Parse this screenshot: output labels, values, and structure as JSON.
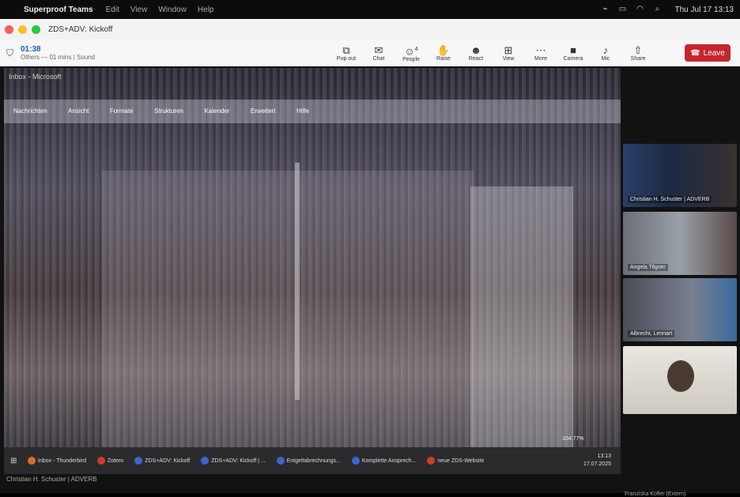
{
  "menubar": {
    "app": "Superproof Teams",
    "menus": [
      "Edit",
      "View",
      "Window",
      "Help"
    ],
    "clock": "Thu Jul 17  13:13"
  },
  "window": {
    "title": "ZDS+ADV: Kickoff",
    "timer": "01:38",
    "others": "Others — 01 mins | Sound",
    "toolbar": [
      {
        "icon": "popout-icon",
        "label": "Pop out"
      },
      {
        "icon": "chat-icon",
        "label": "Chat"
      },
      {
        "icon": "people-icon",
        "label": "People",
        "badge": "4"
      },
      {
        "icon": "raise-hand-icon",
        "label": "Raise"
      },
      {
        "icon": "react-icon",
        "label": "React"
      },
      {
        "icon": "view-icon",
        "label": "View"
      },
      {
        "icon": "more-icon",
        "label": "More"
      },
      {
        "icon": "camera-icon",
        "label": "Camera"
      },
      {
        "icon": "mic-icon",
        "label": "Mic"
      },
      {
        "icon": "share-icon",
        "label": "Share"
      }
    ],
    "leave": "Leave"
  },
  "share": {
    "inner_title": "Inbox - Microsoft",
    "inner_menus": [
      "Nachrichten",
      "Ansicht",
      "Formate",
      "Strukturen",
      "Kalender",
      "Erweitert",
      "Hilfe"
    ],
    "taskbar": [
      {
        "label": "Inbox - Thunderbird"
      },
      {
        "label": "Zotero"
      },
      {
        "label": "ZDS+ADV: Kickoff"
      },
      {
        "label": "ZDS+ADV: Kickoff | ..."
      },
      {
        "label": "Entgeltabrechnungs..."
      },
      {
        "label": "Komplette Ansprech..."
      },
      {
        "label": "neue ZDS-Website"
      }
    ],
    "tray_time": "13:13",
    "tray_date": "17.07.2025",
    "zoom": "104.77%",
    "presenter": "Christian H. Schuster | ADVERB"
  },
  "gallery": [
    {
      "name": "Christian H. Schuster | ADVERB"
    },
    {
      "name": "Angela Tilgner"
    },
    {
      "name": "Albrecht, Lennart"
    },
    {
      "name": ""
    }
  ],
  "right_footer": "Franziska Kofler (Extern)",
  "colors": {
    "leave": "#c4262e",
    "timer": "#1b5fb6"
  }
}
